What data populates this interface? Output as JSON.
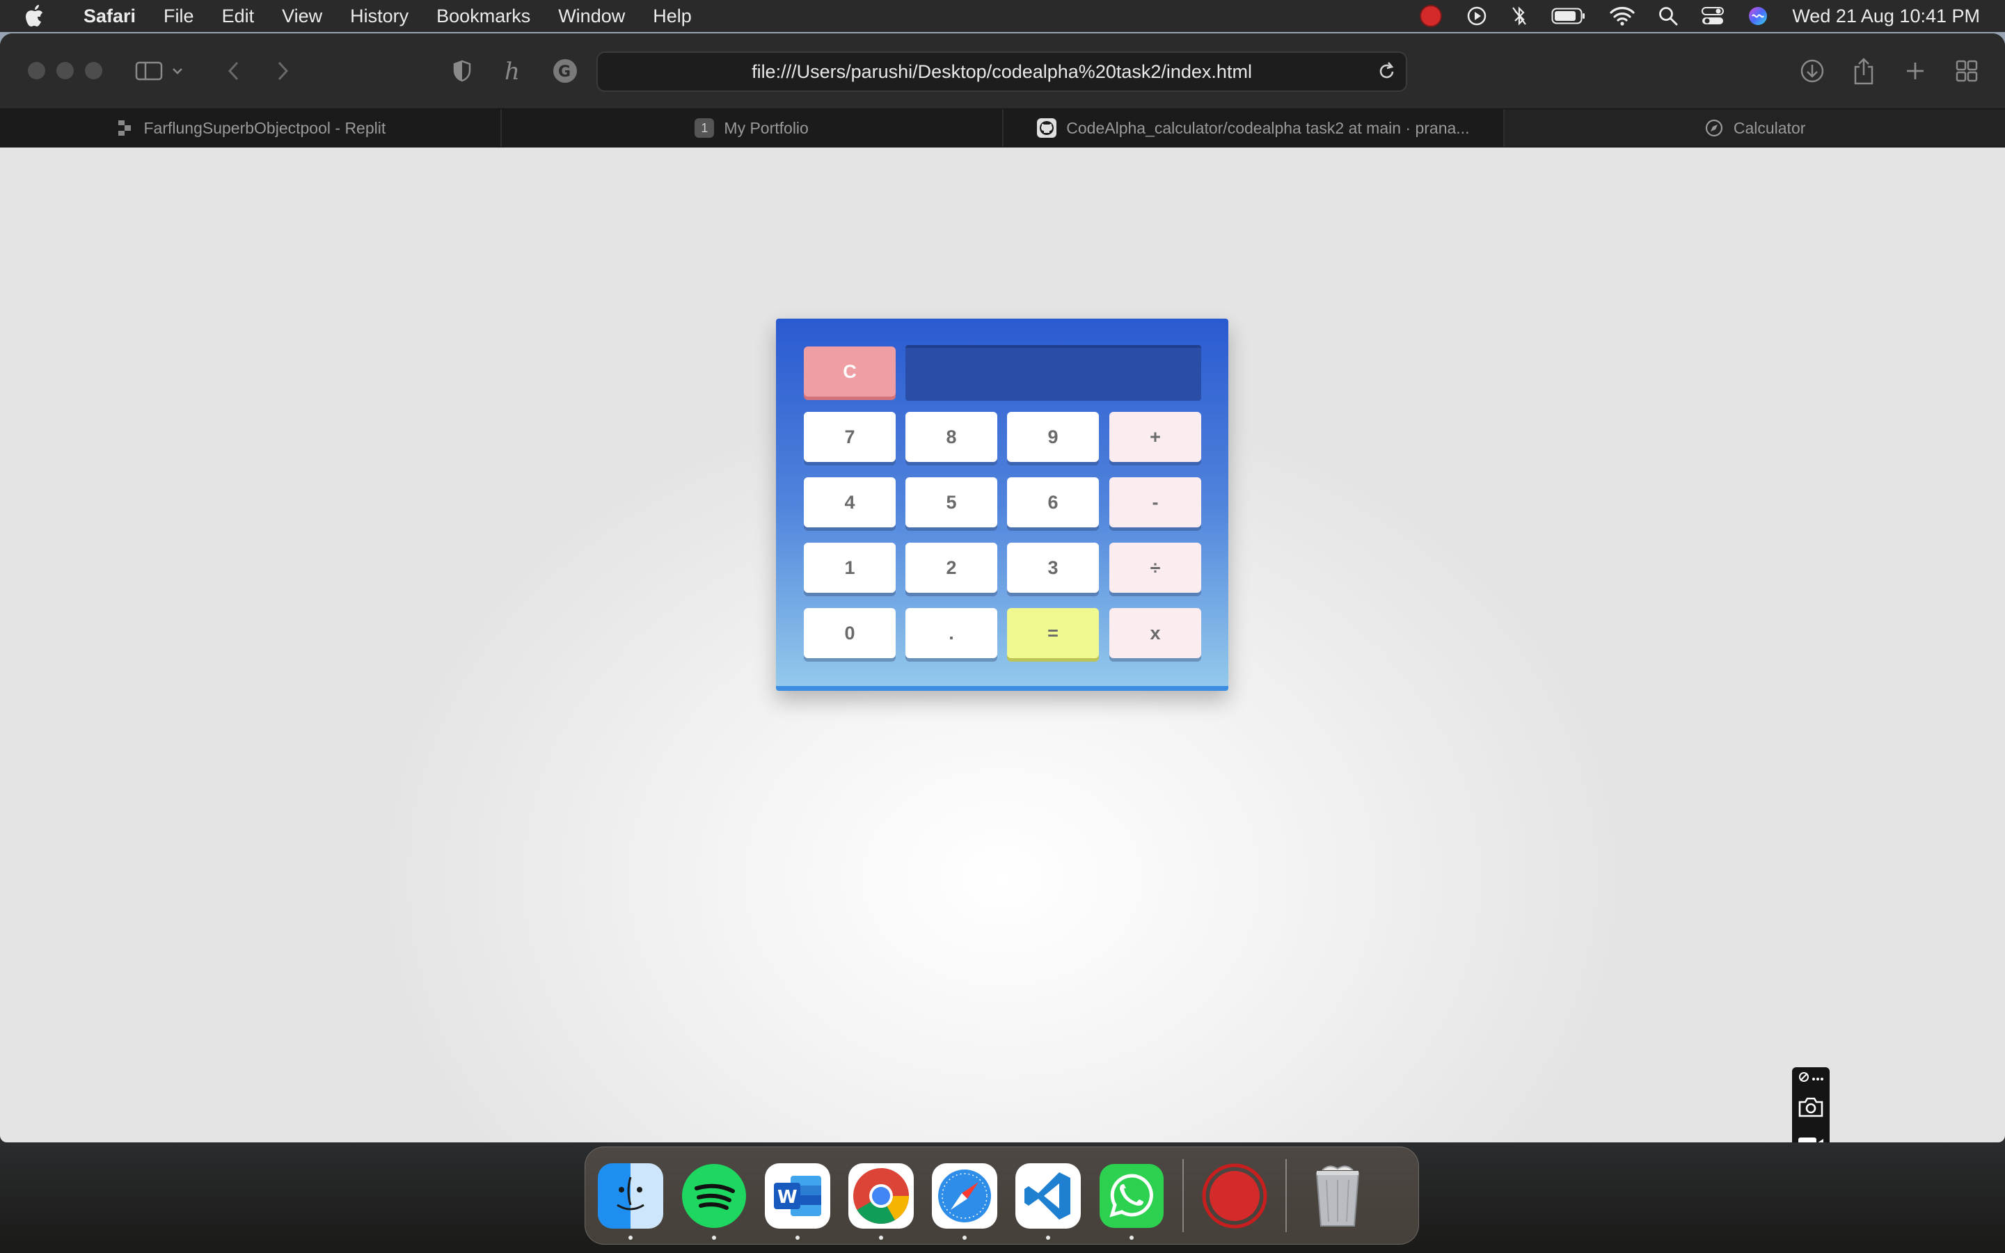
{
  "menubar": {
    "app_name": "Safari",
    "menus": [
      "File",
      "Edit",
      "View",
      "History",
      "Bookmarks",
      "Window",
      "Help"
    ],
    "clock": "Wed 21 Aug  10:41 PM"
  },
  "browser": {
    "url": "file:///Users/parushi/Desktop/codealpha%20task2/index.html",
    "tabs": [
      {
        "label": "FarflungSuperbObjectpool - Replit",
        "icon": "replit-icon"
      },
      {
        "label": "My Portfolio",
        "icon": "numbered-favicon",
        "badge": "1"
      },
      {
        "label": "CodeAlpha_calculator/codealpha task2 at main · prana...",
        "icon": "github-icon"
      },
      {
        "label": "Calculator",
        "icon": "compass-icon"
      }
    ]
  },
  "calculator": {
    "display_value": "",
    "keys": {
      "clear": "C",
      "seven": "7",
      "eight": "8",
      "nine": "9",
      "plus": "+",
      "four": "4",
      "five": "5",
      "six": "6",
      "minus": "-",
      "one": "1",
      "two": "2",
      "three": "3",
      "divide": "÷",
      "zero": "0",
      "decimal": ".",
      "equals": "=",
      "multiply": "x"
    },
    "colors": {
      "body_top": "#2a5ad0",
      "body_bottom": "#94c9ec",
      "clear_key": "#ef9ea3",
      "operator_key": "#fbecef",
      "equals_key": "#eff98f",
      "display": "#2a4ea8"
    }
  },
  "dock": {
    "apps": [
      "Finder",
      "Spotify",
      "Microsoft Word",
      "Google Chrome",
      "Safari",
      "Visual Studio Code",
      "WhatsApp",
      "Screen Recorder",
      "Trash"
    ]
  }
}
